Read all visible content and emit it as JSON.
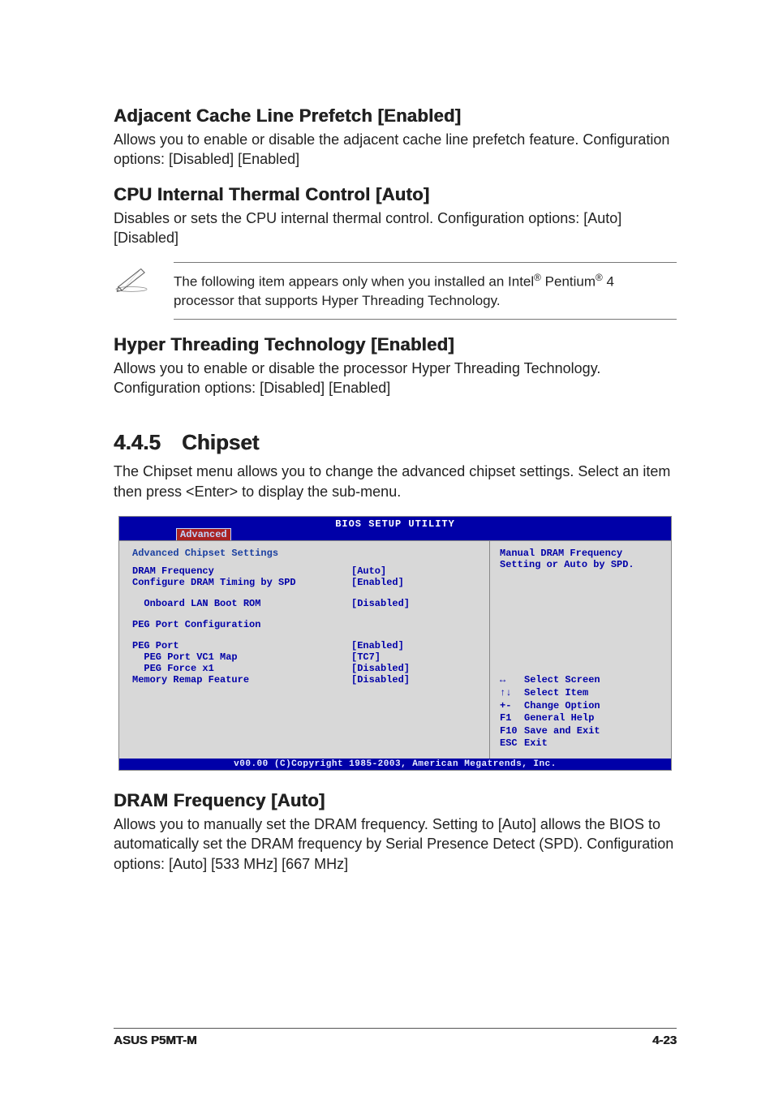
{
  "settings": {
    "adj_cache": {
      "title": "Adjacent Cache Line Prefetch [Enabled]",
      "desc": "Allows you to enable or disable the adjacent cache line prefetch feature. Configuration options: [Disabled] [Enabled]"
    },
    "cpu_thermal": {
      "title": "CPU Internal Thermal Control [Auto]",
      "desc": "Disables or sets the CPU internal thermal control. Configuration options: [Auto] [Disabled]"
    },
    "note": {
      "text_pre": "The following item appears only when you installed an Intel",
      "reg1": "®",
      "text_mid": " Pentium",
      "reg2": "®",
      "text_post": " 4 processor that supports Hyper Threading Technology."
    },
    "hyper": {
      "title": "Hyper Threading Technology [Enabled]",
      "desc": "Allows you to enable or disable the processor Hyper Threading Technology. Configuration options: [Disabled] [Enabled]"
    }
  },
  "section": {
    "number": "4.4.5",
    "title": "Chipset",
    "intro": "The Chipset menu allows you to change the advanced chipset settings. Select an item then press <Enter> to display the sub-menu."
  },
  "bios": {
    "title": "BIOS SETUP UTILITY",
    "tab": "Advanced",
    "heading": "Advanced Chipset Settings",
    "items": [
      {
        "label": "DRAM Frequency",
        "value": "[Auto]"
      },
      {
        "label": "Configure DRAM Timing by SPD",
        "value": "[Enabled]"
      },
      {
        "label": "  Onboard LAN Boot ROM",
        "value": "[Disabled]",
        "spacer_before": true
      },
      {
        "label": "PEG Port Configuration",
        "value": "",
        "spacer_before": true
      },
      {
        "label": "PEG Port",
        "value": "[Enabled]",
        "spacer_before": true
      },
      {
        "label": "  PEG Port VC1 Map",
        "value": "[TC7]"
      },
      {
        "label": "  PEG Force x1",
        "value": "[Disabled]"
      },
      {
        "label": "Memory Remap Feature",
        "value": "[Disabled]"
      }
    ],
    "help": "Manual DRAM Frequency Setting or Auto by SPD.",
    "keys": [
      {
        "icon": "↔",
        "label": "Select Screen"
      },
      {
        "icon": "↑↓",
        "label": "Select Item"
      },
      {
        "icon": "+-",
        "label": "Change Option"
      },
      {
        "icon": "F1",
        "label": "General Help"
      },
      {
        "icon": "F10",
        "label": "Save and Exit"
      },
      {
        "icon": "ESC",
        "label": "Exit"
      }
    ],
    "footer": "v00.00 (C)Copyright 1985-2003, American Megatrends, Inc."
  },
  "dram": {
    "title": "DRAM Frequency [Auto]",
    "desc": "Allows you to manually set the DRAM frequency. Setting to [Auto] allows the BIOS to automatically set the DRAM frequency by Serial Presence Detect (SPD). Configuration options: [Auto] [533 MHz] [667 MHz]"
  },
  "footer": {
    "left": "ASUS P5MT-M",
    "right": "4-23"
  }
}
